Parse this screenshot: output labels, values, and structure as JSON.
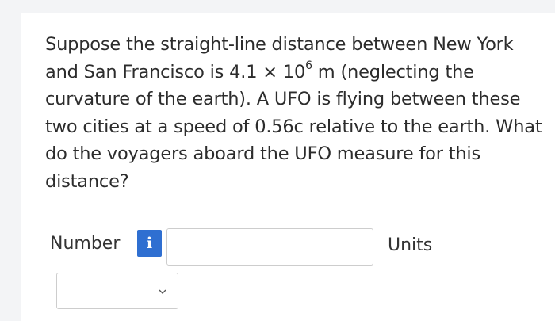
{
  "question": {
    "text_before_exponent": "Suppose the straight-line distance between New York and San Francisco is 4.1 × 10",
    "exponent": "6",
    "text_after_exponent": " m (neglecting the curvature of the earth). A UFO is flying between these two cities at a speed of 0.56c relative to the earth. What do the voyagers aboard the UFO measure for this distance?"
  },
  "answer": {
    "number_label": "Number",
    "info_icon_text": "i",
    "number_value": "",
    "units_label": "Units",
    "units_selected": ""
  },
  "colors": {
    "info_badge": "#2f6fd1",
    "text": "#2c2c2c",
    "input_border": "#cdcdcd"
  },
  "icons": {
    "info": "info-icon",
    "dropdown": "chevron-down-icon"
  }
}
